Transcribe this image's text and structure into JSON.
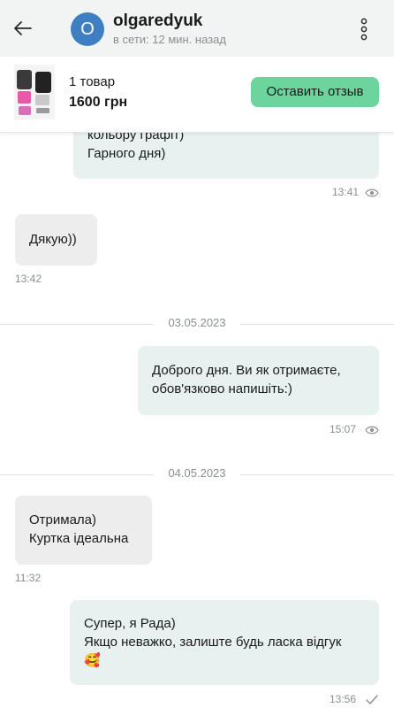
{
  "header": {
    "avatar_letter": "O",
    "username": "olgaredyuk",
    "status": "в сети: 12 мин. назад"
  },
  "product": {
    "items_count": "1 товар",
    "price": "1600 грн",
    "review_button": "Оставить отзыв"
  },
  "messages": {
    "m1": {
      "lines": [
        "кольору графіт)",
        "Гарного дня)"
      ],
      "time": "13:41"
    },
    "m2": {
      "lines": [
        "Дякую))"
      ],
      "time": "13:42"
    },
    "date1": "03.05.2023",
    "m3": {
      "lines": [
        "Доброго дня. Ви як отримаєте,",
        "обов'язково напишіть:)"
      ],
      "time": "15:07"
    },
    "date2": "04.05.2023",
    "m4": {
      "lines": [
        "Отримала)",
        "Куртка ідеальна"
      ],
      "time": "11:32"
    },
    "m5": {
      "lines": [
        "Супер, я Рада)",
        "Якщо неважко, залиште будь ласка відгук",
        "🥰"
      ],
      "time": "13:56"
    }
  },
  "colors": {
    "accent_button": "#6dd49d",
    "avatar": "#3d7fc2",
    "outgoing_bubble": "#e7f1ef",
    "incoming_bubble": "#ededed"
  },
  "icons": {
    "back": "arrow-left-icon",
    "menu": "kebab-menu-icon",
    "seen": "eye-icon",
    "sent": "checkmark-icon"
  }
}
